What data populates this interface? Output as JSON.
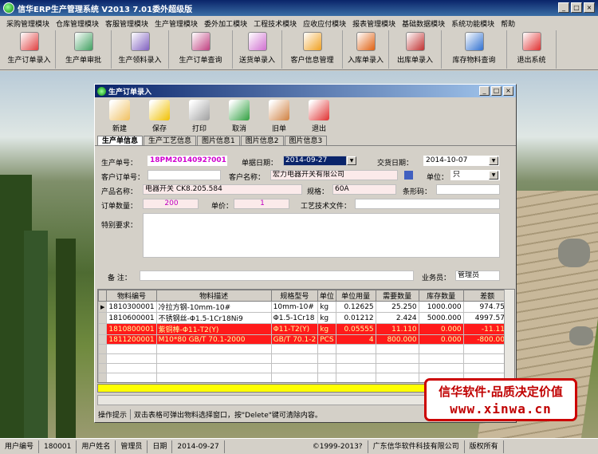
{
  "window": {
    "title": "信华ERP生产管理系统  V2013 7.01委外超级版"
  },
  "menu": [
    "采购管理模块",
    "仓库管理模块",
    "客服管理模块",
    "生产管理模块",
    "委外加工模块",
    "工程技术模块",
    "应收应付模块",
    "报表管理模块",
    "基础数据模块",
    "系统功能模块",
    "帮助"
  ],
  "toolbar": [
    {
      "label": "生产订单录入",
      "icon": "pdf-icon",
      "color": "#e04040"
    },
    {
      "label": "生产单审批",
      "icon": "approve-icon",
      "color": "#40a060"
    },
    {
      "label": "生产领料录入",
      "icon": "issue-material-icon",
      "color": "#8060c0"
    },
    {
      "label": "生产订单查询",
      "icon": "query-icon",
      "color": "#c04080"
    },
    {
      "label": "送货单录入",
      "icon": "delivery-icon",
      "color": "#d070d0"
    },
    {
      "label": "客户信息管理",
      "icon": "customer-icon",
      "color": "#f0a020"
    },
    {
      "label": "入库单录入",
      "icon": "stock-in-icon",
      "color": "#e06010"
    },
    {
      "label": "出库单录入",
      "icon": "stock-out-icon",
      "color": "#c03030"
    },
    {
      "label": "库存物料查询",
      "icon": "inventory-icon",
      "color": "#3070d0"
    },
    {
      "label": "退出系统",
      "icon": "exit-icon",
      "color": "#e03030"
    }
  ],
  "child": {
    "title": "生产订单录入",
    "buttons": [
      {
        "label": "新建",
        "icon": "new-doc-icon",
        "color": "#f0c060"
      },
      {
        "label": "保存",
        "icon": "save-icon",
        "color": "#f0c000"
      },
      {
        "label": "打印",
        "icon": "printer-icon",
        "color": "#a0a0a0"
      },
      {
        "label": "取消",
        "icon": "undo-icon",
        "color": "#30a040"
      },
      {
        "label": "旧单",
        "icon": "old-doc-icon",
        "color": "#d08040"
      },
      {
        "label": "退出",
        "icon": "exit-icon",
        "color": "#e03030"
      }
    ],
    "tabs": [
      "生产单信息",
      "生产工艺信息",
      "图片信息1",
      "图片信息2",
      "图片信息3"
    ],
    "form": {
      "order_no_label": "生产单号：",
      "order_no": "18PM2014092?001",
      "date_label": "单据日期：",
      "date": "2014-09-27",
      "delivery_label": "交货日期：",
      "delivery": "2014-10-07",
      "cust_order_label": "客户订单号：",
      "cust_order": "",
      "cust_name_label": "客户名称：",
      "cust_name": "宏力电器开关有限公司",
      "unit_label": "单位：",
      "unit": "只",
      "product_label": "产品名称：",
      "product": "电器开关 CK8.205.584",
      "spec_label": "规格：",
      "spec": "60A",
      "barcode_label": "条形码：",
      "barcode": "",
      "qty_label": "订单数量：",
      "qty": "200",
      "price_label": "单价：",
      "price": "1",
      "process_label": "工艺技术文件：",
      "process": "",
      "special_label": "特别要求：",
      "special": "",
      "remark_label": "备  注：",
      "remark": "",
      "sales_label": "业务员：",
      "sales": "管理员"
    },
    "grid": {
      "headers": [
        "物料编号",
        "物料描述",
        "规格型号",
        "单位",
        "单位用量",
        "需要数量",
        "库存数量",
        "差额"
      ],
      "rows": [
        {
          "code": "1810300001",
          "desc": "冷拉方钢-10mm-10#",
          "spec": "10mm-10#",
          "unit": "kg",
          "usage": "0.12625",
          "need": "25.250",
          "stock": "1000.000",
          "diff": "974.750",
          "red": false,
          "current": true
        },
        {
          "code": "1810600001",
          "desc": "不锈钢丝-Φ1.5-1Cr18Ni9",
          "spec": "Φ1.5-1Cr18",
          "unit": "kg",
          "usage": "0.01212",
          "need": "2.424",
          "stock": "5000.000",
          "diff": "4997.576",
          "red": false,
          "current": false
        },
        {
          "code": "1810800001",
          "desc": "紫铜棒-Φ11-T2(Y)",
          "spec": "Φ11-T2(Y)",
          "unit": "kg",
          "usage": "0.05555",
          "need": "11.110",
          "stock": "0.000",
          "diff": "-11.110",
          "red": true,
          "current": false
        },
        {
          "code": "1811200001",
          "desc": "M10*80 GB/T 70.1-2000",
          "spec": "GB/T 70.1-2",
          "unit": "PCS",
          "usage": "4",
          "need": "800.000",
          "stock": "0.000",
          "diff": "-800.000",
          "red": true,
          "current": false
        }
      ]
    },
    "hint_label": "操作提示",
    "hint_text": "双击表格可弹出物料选择窗口，按\"Delete\"键可清除内容。"
  },
  "watermark": {
    "line1": "信华软件·品质决定价值",
    "line2": "www.xinwa.cn"
  },
  "status": [
    {
      "label": "用户编号"
    },
    {
      "label": "180001"
    },
    {
      "label": "用户姓名"
    },
    {
      "label": "管理员"
    },
    {
      "label": "日期"
    },
    {
      "label": "2014-09-27"
    },
    {
      "label": "©1999-2013?"
    },
    {
      "label": "广东信华软件科技有限公司"
    },
    {
      "label": "版权所有"
    }
  ]
}
